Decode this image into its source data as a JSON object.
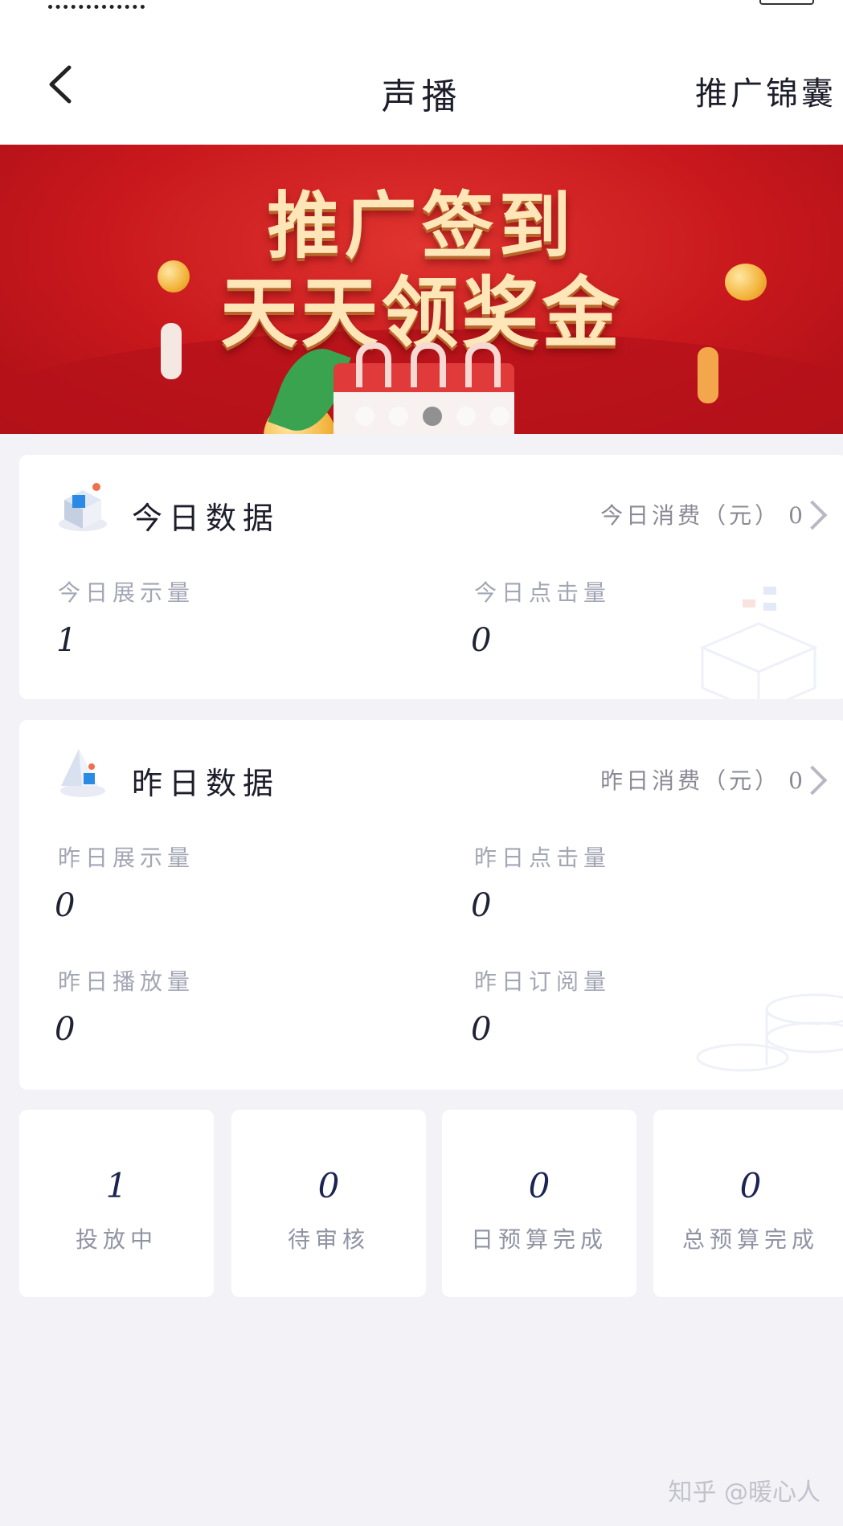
{
  "nav": {
    "title": "声播",
    "right_link": "推广锦囊"
  },
  "banner": {
    "line1": "推广签到",
    "line2": "天天领奖金",
    "slide_count": 5,
    "active_slide": 3,
    "colors": {
      "background": "#c8181d",
      "text": "#ffe6b8"
    }
  },
  "today": {
    "title": "今日数据",
    "cost_label": "今日消费（元）",
    "cost_value": "0",
    "metrics": [
      {
        "label": "今日展示量",
        "value": "1"
      },
      {
        "label": "今日点击量",
        "value": "0"
      }
    ]
  },
  "yesterday": {
    "title": "昨日数据",
    "cost_label": "昨日消费（元）",
    "cost_value": "0",
    "metrics": [
      {
        "label": "昨日展示量",
        "value": "0"
      },
      {
        "label": "昨日点击量",
        "value": "0"
      },
      {
        "label": "昨日播放量",
        "value": "0"
      },
      {
        "label": "昨日订阅量",
        "value": "0"
      }
    ]
  },
  "stats": [
    {
      "value": "1",
      "label": "投放中"
    },
    {
      "value": "0",
      "label": "待审核"
    },
    {
      "value": "0",
      "label": "日预算完成"
    },
    {
      "value": "0",
      "label": "总预算完成"
    }
  ],
  "watermark": "知乎 @暖心人",
  "icons": {
    "back": "chevron-left-icon",
    "today": "cube-icon",
    "yesterday": "pyramid-icon",
    "arrow": "chevron-right-icon"
  }
}
